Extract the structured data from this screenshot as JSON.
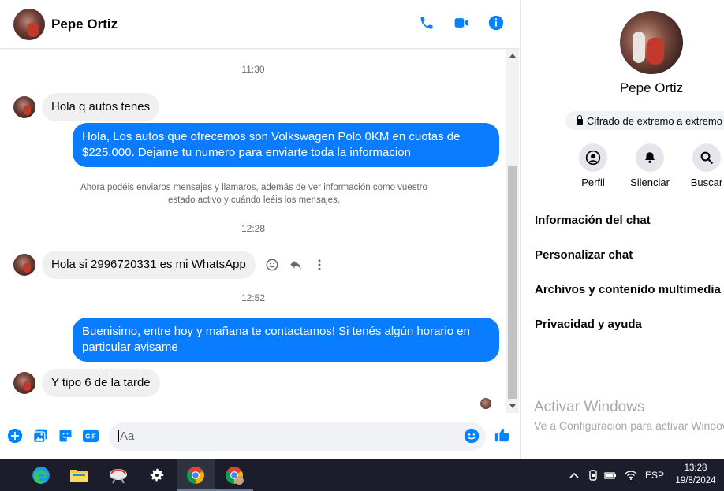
{
  "header": {
    "contact_name": "Pepe Ortiz"
  },
  "messages": {
    "time_1": "11:30",
    "msg_1": "Hola q autos tenes",
    "msg_2": "Hola, Los autos que ofrecemos son Volkswagen Polo 0KM en cuotas de $225.000. Dejame tu numero para enviarte toda la informacion",
    "notice": "Ahora podéis enviaros mensajes y llamaros, además de ver información como vuestro estado activo y cuándo leéis los mensajes.",
    "time_2": "12:28",
    "msg_3": "Hola si 2996720331 es mi WhatsApp",
    "time_3": "12:52",
    "msg_4": "Buenisimo, entre hoy y mañana te contactamos! Si tenés algún horario en particular avisame",
    "msg_5": "Y tipo 6 de la tarde"
  },
  "composer": {
    "placeholder": "Aa"
  },
  "panel": {
    "name": "Pepe Ortiz",
    "encryption": "Cifrado de extremo a extremo",
    "actions": [
      "Perfil",
      "Silenciar",
      "Buscar"
    ],
    "items": [
      "Información del chat",
      "Personalizar chat",
      "Archivos y contenido multimedia",
      "Privacidad y ayuda"
    ]
  },
  "watermark": {
    "title": "Activar Windows",
    "subtitle": "Ve a Configuración para activar Windows."
  },
  "taskbar": {
    "lang": "ESP",
    "time": "13:28",
    "date": "19/8/2024"
  },
  "colors": {
    "accent": "#0a7cff",
    "messenger_blue": "#0084ff"
  }
}
